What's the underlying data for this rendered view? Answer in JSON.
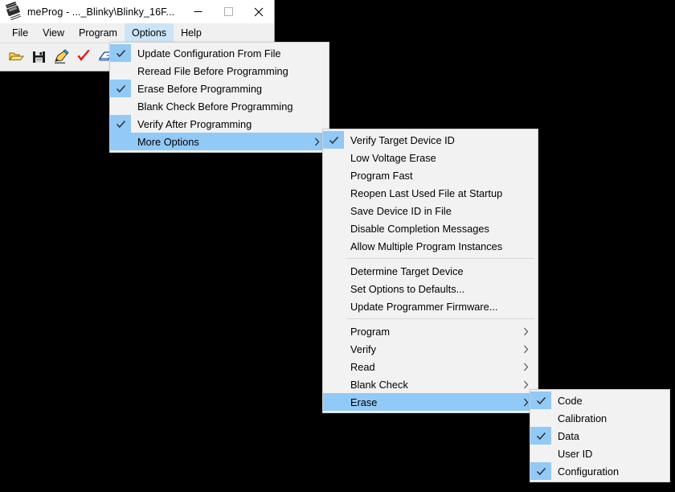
{
  "window": {
    "title": "meProg - ..._Blinky\\Blinky_16F...",
    "icon": "chip-icon",
    "controls": [
      {
        "name": "minimize",
        "glyph": "minimize-icon"
      },
      {
        "name": "maximize",
        "glyph": "maximize-icon"
      },
      {
        "name": "close",
        "glyph": "close-icon"
      }
    ],
    "menubar": [
      {
        "label": "File",
        "active": false
      },
      {
        "label": "View",
        "active": false
      },
      {
        "label": "Program",
        "active": false
      },
      {
        "label": "Options",
        "active": true
      },
      {
        "label": "Help",
        "active": false
      }
    ],
    "toolbar": [
      {
        "name": "open-file-icon"
      },
      {
        "name": "save-file-icon"
      },
      {
        "name": "write-program-icon"
      },
      {
        "name": "verify-check-icon"
      },
      {
        "name": "erase-icon"
      },
      {
        "name": "blank-check-icon"
      }
    ]
  },
  "menu_options": {
    "name": "options-menu",
    "items": [
      {
        "label": "Update Configuration From File",
        "checked": true,
        "selected": false,
        "submenu": false
      },
      {
        "label": "Reread File Before Programming",
        "checked": false,
        "selected": false,
        "submenu": false
      },
      {
        "label": "Erase Before Programming",
        "checked": true,
        "selected": false,
        "submenu": false
      },
      {
        "label": "Blank Check Before Programming",
        "checked": false,
        "selected": false,
        "submenu": false
      },
      {
        "label": "Verify After Programming",
        "checked": true,
        "selected": false,
        "submenu": false
      },
      {
        "label": "More Options",
        "checked": false,
        "selected": true,
        "submenu": true
      }
    ]
  },
  "menu_more_options": {
    "name": "more-options-menu",
    "items": [
      {
        "label": "Verify Target Device ID",
        "checked": true,
        "selected": false,
        "submenu": false,
        "separator_after": false
      },
      {
        "label": "Low Voltage Erase",
        "checked": false,
        "selected": false,
        "submenu": false,
        "separator_after": false
      },
      {
        "label": "Program Fast",
        "checked": false,
        "selected": false,
        "submenu": false,
        "separator_after": false
      },
      {
        "label": "Reopen Last Used File at Startup",
        "checked": false,
        "selected": false,
        "submenu": false,
        "separator_after": false
      },
      {
        "label": "Save Device ID in File",
        "checked": false,
        "selected": false,
        "submenu": false,
        "separator_after": false
      },
      {
        "label": "Disable Completion Messages",
        "checked": false,
        "selected": false,
        "submenu": false,
        "separator_after": false
      },
      {
        "label": "Allow Multiple Program Instances",
        "checked": false,
        "selected": false,
        "submenu": false,
        "separator_after": true
      },
      {
        "label": "Determine Target Device",
        "checked": false,
        "selected": false,
        "submenu": false,
        "separator_after": false
      },
      {
        "label": "Set Options to Defaults...",
        "checked": false,
        "selected": false,
        "submenu": false,
        "separator_after": false
      },
      {
        "label": "Update Programmer Firmware...",
        "checked": false,
        "selected": false,
        "submenu": false,
        "separator_after": true
      },
      {
        "label": "Program",
        "checked": false,
        "selected": false,
        "submenu": true,
        "separator_after": false
      },
      {
        "label": "Verify",
        "checked": false,
        "selected": false,
        "submenu": true,
        "separator_after": false
      },
      {
        "label": "Read",
        "checked": false,
        "selected": false,
        "submenu": true,
        "separator_after": false
      },
      {
        "label": "Blank Check",
        "checked": false,
        "selected": false,
        "submenu": true,
        "separator_after": false
      },
      {
        "label": "Erase",
        "checked": false,
        "selected": true,
        "submenu": true,
        "separator_after": false
      }
    ]
  },
  "menu_erase": {
    "name": "erase-submenu",
    "items": [
      {
        "label": "Code",
        "checked": true,
        "selected": false,
        "submenu": false
      },
      {
        "label": "Calibration",
        "checked": false,
        "selected": false,
        "submenu": false
      },
      {
        "label": "Data",
        "checked": true,
        "selected": false,
        "submenu": false
      },
      {
        "label": "User ID",
        "checked": false,
        "selected": false,
        "submenu": false
      },
      {
        "label": "Configuration",
        "checked": true,
        "selected": false,
        "submenu": false
      }
    ]
  },
  "colors": {
    "menu_bg": "#f2f2f2",
    "highlight": "#91c9f7",
    "menubar_active": "#cce4f7",
    "window_bg": "#f0f0f0",
    "desktop": "#000000"
  }
}
